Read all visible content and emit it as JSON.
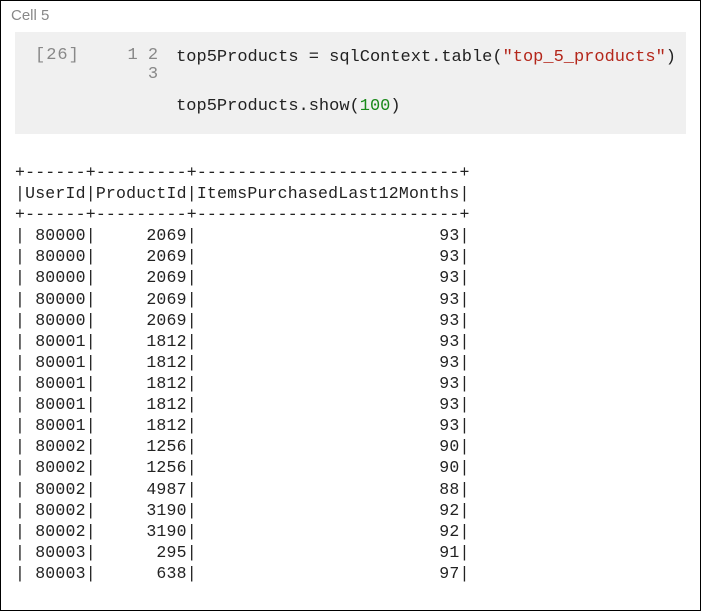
{
  "cell_label": "Cell 5",
  "exec_count": "[26]",
  "code": {
    "line_numbers": [
      "1",
      "2",
      "3"
    ],
    "line1_a": "top5Products = sqlContext.table(",
    "line1_str": "\"top_5_products\"",
    "line1_b": ")",
    "line3_a": "top5Products.show(",
    "line3_num": "100",
    "line3_b": ")"
  },
  "table": {
    "columns": [
      "UserId",
      "ProductId",
      "ItemsPurchasedLast12Months"
    ],
    "rows": [
      {
        "UserId": 80000,
        "ProductId": 2069,
        "ItemsPurchasedLast12Months": 93
      },
      {
        "UserId": 80000,
        "ProductId": 2069,
        "ItemsPurchasedLast12Months": 93
      },
      {
        "UserId": 80000,
        "ProductId": 2069,
        "ItemsPurchasedLast12Months": 93
      },
      {
        "UserId": 80000,
        "ProductId": 2069,
        "ItemsPurchasedLast12Months": 93
      },
      {
        "UserId": 80000,
        "ProductId": 2069,
        "ItemsPurchasedLast12Months": 93
      },
      {
        "UserId": 80001,
        "ProductId": 1812,
        "ItemsPurchasedLast12Months": 93
      },
      {
        "UserId": 80001,
        "ProductId": 1812,
        "ItemsPurchasedLast12Months": 93
      },
      {
        "UserId": 80001,
        "ProductId": 1812,
        "ItemsPurchasedLast12Months": 93
      },
      {
        "UserId": 80001,
        "ProductId": 1812,
        "ItemsPurchasedLast12Months": 93
      },
      {
        "UserId": 80001,
        "ProductId": 1812,
        "ItemsPurchasedLast12Months": 93
      },
      {
        "UserId": 80002,
        "ProductId": 1256,
        "ItemsPurchasedLast12Months": 90
      },
      {
        "UserId": 80002,
        "ProductId": 1256,
        "ItemsPurchasedLast12Months": 90
      },
      {
        "UserId": 80002,
        "ProductId": 4987,
        "ItemsPurchasedLast12Months": 88
      },
      {
        "UserId": 80002,
        "ProductId": 3190,
        "ItemsPurchasedLast12Months": 92
      },
      {
        "UserId": 80002,
        "ProductId": 3190,
        "ItemsPurchasedLast12Months": 92
      },
      {
        "UserId": 80003,
        "ProductId": 295,
        "ItemsPurchasedLast12Months": 91
      },
      {
        "UserId": 80003,
        "ProductId": 638,
        "ItemsPurchasedLast12Months": 97
      }
    ]
  }
}
